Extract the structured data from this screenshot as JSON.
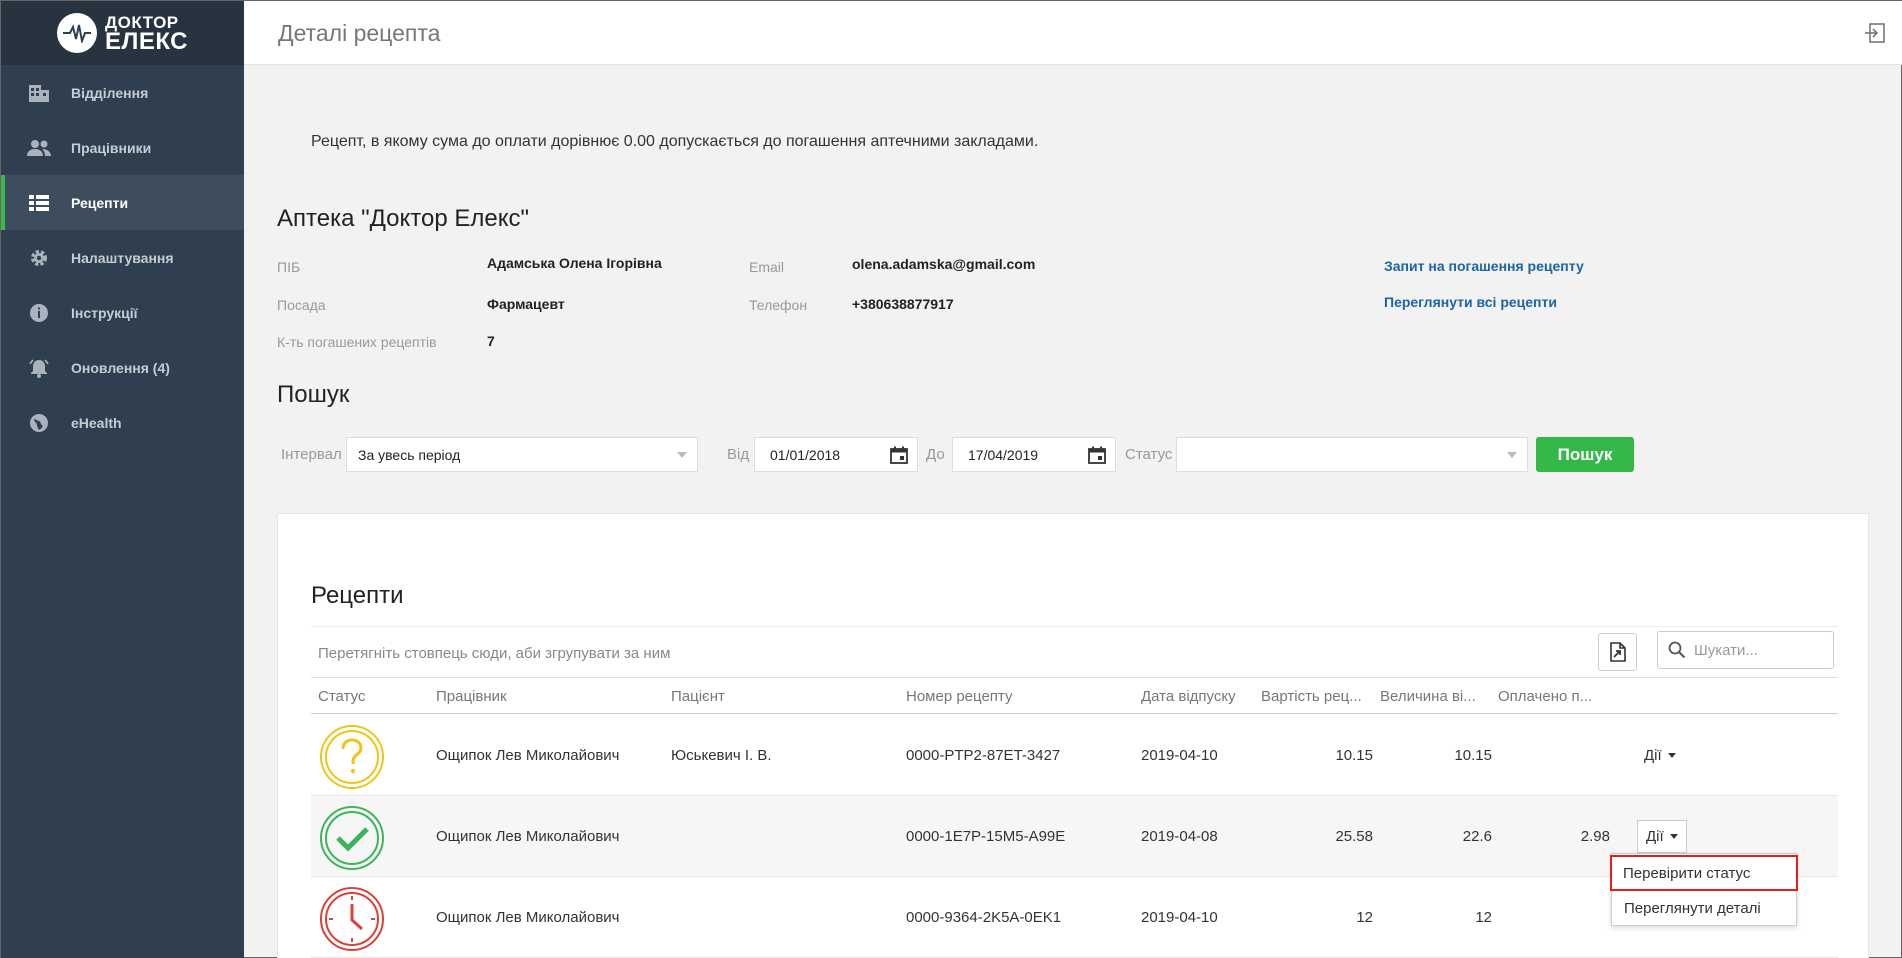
{
  "brand": {
    "line1": "ДОКТОР",
    "line2": "ЕЛЕКС"
  },
  "sidebar": {
    "items": [
      {
        "label": "Відділення",
        "icon": "building-icon"
      },
      {
        "label": "Працівники",
        "icon": "people-icon"
      },
      {
        "label": "Рецепти",
        "icon": "list-icon",
        "active": true
      },
      {
        "label": "Налаштування",
        "icon": "gear-icon"
      },
      {
        "label": "Інструкції",
        "icon": "info-icon"
      },
      {
        "label": "Оновлення (4)",
        "icon": "bell-icon"
      },
      {
        "label": "eHealth",
        "icon": "globe-icon"
      }
    ]
  },
  "header": {
    "title": "Деталі рецепта"
  },
  "notice": "Рецепт, в якому сума до оплати дорівнює 0.00 допускається до погашення аптечними закладами.",
  "pharmacy": {
    "title": "Аптека \"Доктор Елекс\"",
    "pib_label": "ПІБ",
    "pib_value": "Адамська Олена Ігорівна",
    "position_label": "Посада",
    "position_value": "Фармацевт",
    "count_label": "К-ть погашених рецептів",
    "count_value": "7",
    "email_label": "Email",
    "email_value": "olena.adamska@gmail.com",
    "phone_label": "Телефон",
    "phone_value": "+380638877917",
    "link_request": "Запит на погашення рецепту",
    "link_all": "Переглянути всі рецепти"
  },
  "search": {
    "title": "Пошук",
    "interval_label": "Інтервал",
    "interval_value": "За увесь період",
    "from_label": "Від",
    "from_value": "01/01/2018",
    "to_label": "До",
    "to_value": "17/04/2019",
    "status_label": "Статус",
    "status_value": "",
    "button": "Пошук"
  },
  "recipes": {
    "title": "Рецепти",
    "group_hint": "Перетягніть стовпець сюди, аби згрупувати за ним",
    "search_placeholder": "Шукати...",
    "columns": [
      "Статус",
      "Працівник",
      "Пацієнт",
      "Номер рецепту",
      "Дата відпуску",
      "Вартість рец...",
      "Величина ві...",
      "Оплачено п..."
    ],
    "rows": [
      {
        "status": "question",
        "color": "#f0c419",
        "employee": "Ощипок Лев Миколайович",
        "patient": "Юськевич І. В.",
        "number": "0000-PTP2-87ET-3427",
        "date": "2019-04-10",
        "cost": "10.15",
        "amount": "10.15",
        "paid": "",
        "actions": "Дії"
      },
      {
        "status": "check",
        "color": "#3cb55a",
        "employee": "Ощипок Лев Миколайович",
        "patient": "",
        "number": "0000-1E7P-15M5-A99E",
        "date": "2019-04-08",
        "cost": "25.58",
        "amount": "22.6",
        "paid": "2.98",
        "actions": "Дії"
      },
      {
        "status": "clock",
        "color": "#d9413a",
        "employee": "Ощипок Лев Миколайович",
        "patient": "",
        "number": "0000-9364-2K5A-0EK1",
        "date": "2019-04-10",
        "cost": "12",
        "amount": "12",
        "paid": "",
        "actions": ""
      }
    ],
    "dropdown": [
      "Перевірити статус",
      "Переглянути деталі"
    ]
  }
}
